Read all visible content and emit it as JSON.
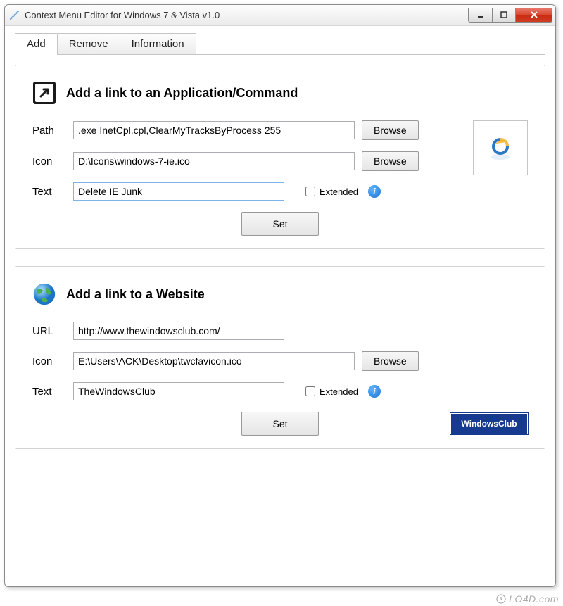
{
  "window": {
    "title": "Context Menu Editor for Windows 7 & Vista v1.0"
  },
  "tabs": {
    "add": "Add",
    "remove": "Remove",
    "information": "Information"
  },
  "sectionApp": {
    "heading": "Add a link to an Application/Command",
    "pathLabel": "Path",
    "pathValue": ".exe InetCpl.cpl,ClearMyTracksByProcess 255",
    "iconLabel": "Icon",
    "iconValue": "D:\\Icons\\windows-7-ie.ico",
    "textLabel": "Text",
    "textValue": "Delete IE Junk",
    "browse": "Browse",
    "extended": "Extended",
    "set": "Set"
  },
  "sectionWeb": {
    "heading": "Add a link to a Website",
    "urlLabel": "URL",
    "urlValue": "http://www.thewindowsclub.com/",
    "iconLabel": "Icon",
    "iconValue": "E:\\Users\\ACK\\Desktop\\twcfavicon.ico",
    "textLabel": "Text",
    "textValue": "TheWindowsClub",
    "browse": "Browse",
    "extended": "Extended",
    "set": "Set",
    "badge": "WindowsClub"
  },
  "watermark": "LO4D.com"
}
